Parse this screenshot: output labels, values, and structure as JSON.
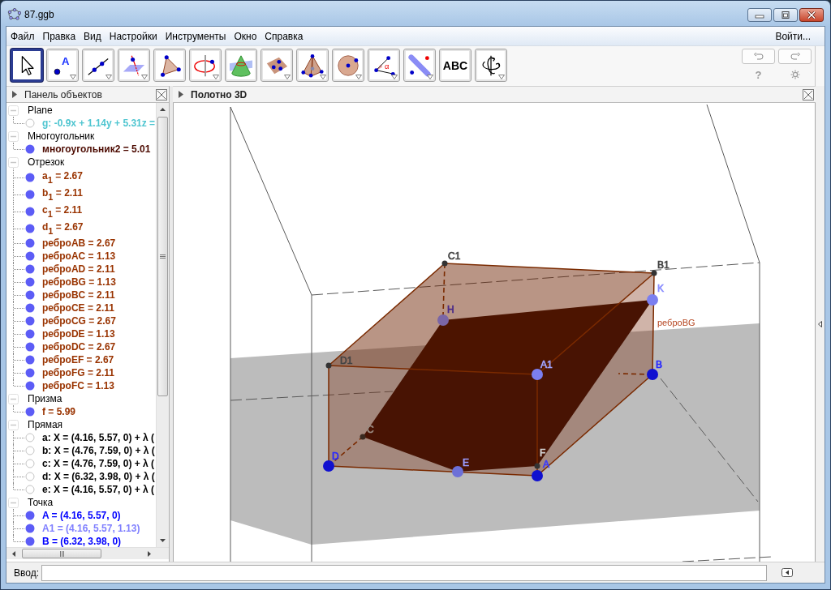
{
  "window": {
    "title": "87.ggb"
  },
  "menu": {
    "items": [
      "Файл",
      "Правка",
      "Вид",
      "Настройки",
      "Инструменты",
      "Окно",
      "Справка"
    ],
    "login": "Войти..."
  },
  "toolbar": {
    "tools": [
      {
        "kind": "move",
        "selected": true,
        "has_menu": false
      },
      {
        "kind": "point",
        "glyph": "A",
        "selected": false,
        "has_menu": true
      },
      {
        "kind": "line",
        "selected": false,
        "has_menu": true
      },
      {
        "kind": "perpendicular",
        "selected": false,
        "has_menu": true
      },
      {
        "kind": "polygon",
        "selected": false,
        "has_menu": false
      },
      {
        "kind": "circle",
        "selected": false,
        "has_menu": true
      },
      {
        "kind": "cone",
        "selected": false,
        "has_menu": false
      },
      {
        "kind": "plane",
        "selected": false,
        "has_menu": true
      },
      {
        "kind": "pyramid",
        "selected": false,
        "has_menu": true
      },
      {
        "kind": "sphere",
        "selected": false,
        "has_menu": true
      },
      {
        "kind": "angle",
        "glyph": "α",
        "selected": false,
        "has_menu": true
      },
      {
        "kind": "reflect",
        "selected": false,
        "has_menu": true
      },
      {
        "kind": "text",
        "label": "ABC",
        "selected": false,
        "has_menu": false
      },
      {
        "kind": "rotate",
        "selected": false,
        "has_menu": true
      }
    ],
    "help": "?"
  },
  "algebra_panel": {
    "title": "Панель объектов",
    "groups": [
      {
        "label": "Plane",
        "expanded": true,
        "items": [
          {
            "text": "g: -0.9x + 1.14y + 5.31z =",
            "visible": false,
            "color": "#4ec5d0"
          }
        ]
      },
      {
        "label": "Многоугольник",
        "expanded": true,
        "items": [
          {
            "text": "многоугольник2 = 5.01",
            "visible": true,
            "color": "#4c0a00"
          }
        ]
      },
      {
        "label": "Отрезок",
        "expanded": true,
        "items": [
          {
            "text": "a$_{1}$ = 2.67",
            "visible": true,
            "color": "#993300"
          },
          {
            "text": "b$_{1}$ = 2.11",
            "visible": true,
            "color": "#993300"
          },
          {
            "text": "c$_{1}$ = 2.11",
            "visible": true,
            "color": "#993300"
          },
          {
            "text": "d$_{1}$ = 2.67",
            "visible": true,
            "color": "#993300"
          },
          {
            "text": "реброAB = 2.67",
            "visible": true,
            "color": "#993300"
          },
          {
            "text": "реброAC = 1.13",
            "visible": true,
            "color": "#993300"
          },
          {
            "text": "реброAD = 2.11",
            "visible": true,
            "color": "#993300"
          },
          {
            "text": "реброBG = 1.13",
            "visible": true,
            "color": "#993300"
          },
          {
            "text": "реброBC = 2.11",
            "visible": true,
            "color": "#993300"
          },
          {
            "text": "реброCE = 2.11",
            "visible": true,
            "color": "#993300"
          },
          {
            "text": "реброCG = 2.67",
            "visible": true,
            "color": "#993300"
          },
          {
            "text": "реброDE = 1.13",
            "visible": true,
            "color": "#993300"
          },
          {
            "text": "реброDC = 2.67",
            "visible": true,
            "color": "#993300"
          },
          {
            "text": "реброEF = 2.67",
            "visible": true,
            "color": "#993300"
          },
          {
            "text": "реброFG = 2.11",
            "visible": true,
            "color": "#993300"
          },
          {
            "text": "реброFC = 1.13",
            "visible": true,
            "color": "#993300"
          }
        ]
      },
      {
        "label": "Призма",
        "expanded": true,
        "items": [
          {
            "text": "f = 5.99",
            "visible": true,
            "color": "#993300"
          }
        ]
      },
      {
        "label": "Прямая",
        "expanded": true,
        "items": [
          {
            "text": "a: X = (4.16, 5.57, 0) + λ (",
            "visible": false,
            "color": "#000000"
          },
          {
            "text": "b: X = (4.76, 7.59, 0) + λ (",
            "visible": false,
            "color": "#000000"
          },
          {
            "text": "c: X = (4.76, 7.59, 0) + λ (",
            "visible": false,
            "color": "#000000"
          },
          {
            "text": "d: X = (6.32, 3.98, 0) + λ (",
            "visible": false,
            "color": "#000000"
          },
          {
            "text": "e: X = (4.16, 5.57, 0) + λ (",
            "visible": false,
            "color": "#000000"
          }
        ]
      },
      {
        "label": "Точка",
        "expanded": true,
        "items": [
          {
            "text": "A = (4.16, 5.57, 0)",
            "visible": true,
            "color": "#0000ff"
          },
          {
            "text": "A1 = (4.16, 5.57, 1.13)",
            "visible": true,
            "color": "#7f7fff"
          },
          {
            "text": "B = (6.32, 3.98, 0)",
            "visible": true,
            "color": "#0000ff"
          }
        ]
      }
    ]
  },
  "view_3d": {
    "title": "Полотно 3D",
    "points": [
      {
        "kind": "vertex",
        "color": "#333333"
      },
      {
        "kind": "vertex",
        "color": "#333333"
      },
      {
        "kind": "sphere",
        "color": "#7b7ff0"
      },
      {
        "kind": "sphere",
        "color": "#7a66a6"
      },
      {
        "kind": "vertex",
        "color": "#333333"
      },
      {
        "kind": "sphere",
        "color": "#7b7ff0"
      },
      {
        "kind": "sphere",
        "color": "#1010d0"
      },
      {
        "kind": "vertex",
        "color": "#3a2a20"
      },
      {
        "kind": "sphere",
        "color": "#1010d0"
      },
      {
        "kind": "sphere",
        "color": "#6d70d8"
      },
      {
        "kind": "vertex",
        "color": "#333333"
      },
      {
        "kind": "sphere",
        "color": "#1010d0"
      }
    ],
    "labels": [
      {
        "text": "C1",
        "color": "#444444"
      },
      {
        "text": "B1",
        "color": "#444444"
      },
      {
        "text": "K",
        "color": "#8c8fff"
      },
      {
        "text": "H",
        "color": "#4a2a88"
      },
      {
        "text": "D1",
        "color": "#444444"
      },
      {
        "text": "A1",
        "color": "#a0a4ff"
      },
      {
        "text": "B",
        "color": "#2a2aff"
      },
      {
        "text": "C",
        "color": "#9a8a80"
      },
      {
        "text": "D",
        "color": "#2a2aff"
      },
      {
        "text": "E",
        "color": "#9a9dff"
      },
      {
        "text": "F",
        "color": "#d0d0d0"
      },
      {
        "text": "A",
        "color": "#3a3aff"
      }
    ],
    "edge_label": "реброBG"
  },
  "input_bar": {
    "label": "Ввод:"
  }
}
